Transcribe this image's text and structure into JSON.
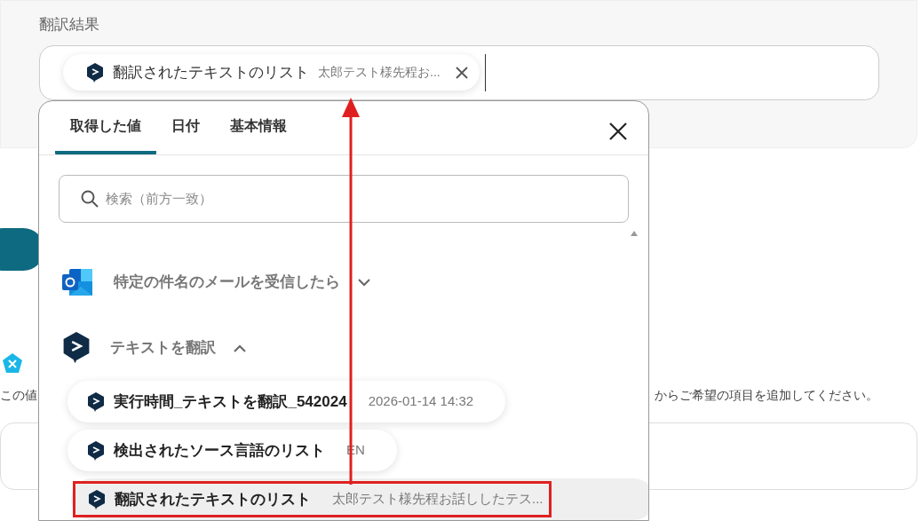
{
  "field": {
    "label": "翻訳結果",
    "chip": {
      "title": "翻訳されたテキストのリスト",
      "value": "太郎テスト様先程お..."
    }
  },
  "note": {
    "left": "この値",
    "right": "からご希望の項目を追加してください。"
  },
  "popup": {
    "tabs": [
      {
        "label": "取得した値",
        "selected": true
      },
      {
        "label": "日付",
        "selected": false
      },
      {
        "label": "基本情報",
        "selected": false
      }
    ],
    "search": {
      "placeholder": "検索（前方一致）"
    },
    "groups": [
      {
        "kind": "outlook",
        "title": "特定の件名のメールを受信したら",
        "expanded": false
      },
      {
        "kind": "deepl",
        "title": "テキストを翻訳",
        "expanded": true,
        "items": [
          {
            "title": "実行時間_テキストを翻訳_542024",
            "value": "2026-01-14 14:32",
            "selected": false
          },
          {
            "title": "検出されたソース言語のリスト",
            "value": "EN",
            "selected": false
          },
          {
            "title": "翻訳されたテキストのリスト",
            "value": "太郎テスト様先程お話ししたテス...",
            "selected": true
          }
        ]
      }
    ]
  }
}
